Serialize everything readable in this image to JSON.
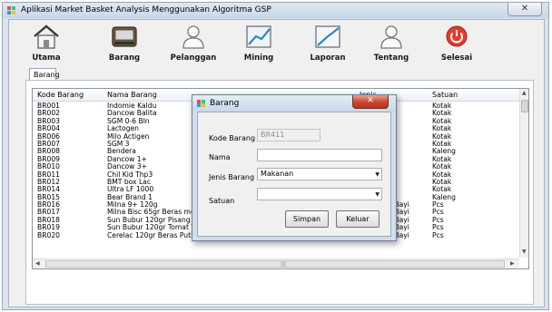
{
  "window": {
    "title": "Aplikasi Market Basket Analysis Menggunakan Algoritma GSP",
    "close_glyph": "✕"
  },
  "toolbar": {
    "items": [
      {
        "label": "Utama",
        "icon": "home-icon"
      },
      {
        "label": "Barang",
        "icon": "box-icon"
      },
      {
        "label": "Pelanggan",
        "icon": "user-icon"
      },
      {
        "label": "Mining",
        "icon": "chart-icon"
      },
      {
        "label": "Laporan",
        "icon": "report-icon"
      },
      {
        "label": "Tentang",
        "icon": "about-icon"
      },
      {
        "label": "Selesai",
        "icon": "power-icon"
      }
    ]
  },
  "tab": {
    "label": "Barang"
  },
  "grid": {
    "columns": [
      "Kode Barang",
      "Nama Barang",
      "Jenis",
      "Satuan"
    ],
    "rows": [
      [
        "BR001",
        "Indomie Kaldu",
        "",
        "Kotak"
      ],
      [
        "BR002",
        "Dancow Balita",
        "",
        "Kotak"
      ],
      [
        "BR003",
        "SGM 0-6 Bln",
        "",
        "Kotak"
      ],
      [
        "BR004",
        "Lactogen",
        "",
        "Kotak"
      ],
      [
        "BR006",
        "Milo Actigen",
        "",
        "Kotak"
      ],
      [
        "BR007",
        "SGM 3",
        "",
        "Kotak"
      ],
      [
        "BR008",
        "Bendera",
        "",
        "Kaleng"
      ],
      [
        "BR009",
        "Dancow 1+",
        "",
        "Kotak"
      ],
      [
        "BR010",
        "Dancow 3+",
        "",
        "Kotak"
      ],
      [
        "BR011",
        "Chil Kid Thp3",
        "",
        "Kotak"
      ],
      [
        "BR012",
        "BMT box Lac",
        "",
        "Kotak"
      ],
      [
        "BR014",
        "Ultra LF 1000",
        "",
        "Kotak"
      ],
      [
        "BR015",
        "Bear Brand 1",
        "",
        "Kaleng"
      ],
      [
        "BR016",
        "Milna 9+ 120g",
        "Peralatan Bayi",
        "Pcs"
      ],
      [
        "BR017",
        "Milna Bisc 65gr Beras merah",
        "Peralatan Bayi",
        "Pcs"
      ],
      [
        "BR018",
        "Sun Bubur 120gr Pisang",
        "Peralatan Bayi",
        "Pcs"
      ],
      [
        "BR019",
        "Sun Bubur 120gr Tomat Wortel",
        "Peralatan Bayi",
        "Pcs"
      ],
      [
        "BR020",
        "Cerelac 120gr Beras Putih",
        "Peralatan Bayi",
        "Pcs"
      ]
    ]
  },
  "buttons": {
    "add": "+",
    "remove": "–"
  },
  "dialog": {
    "title": "Barang",
    "close_glyph": "✕",
    "fields": {
      "kode_label": "Kode Barang",
      "kode_value": "BR411",
      "nama_label": "Nama",
      "nama_value": "",
      "jenis_label": "Jenis Barang",
      "jenis_value": "Makanan",
      "satuan_label": "Satuan",
      "satuan_value": ""
    },
    "save_label": "Simpan",
    "exit_label": "Keluar"
  },
  "colors": {
    "power_icon": "#e53a2c",
    "accent_blue": "#3c7fb1"
  }
}
